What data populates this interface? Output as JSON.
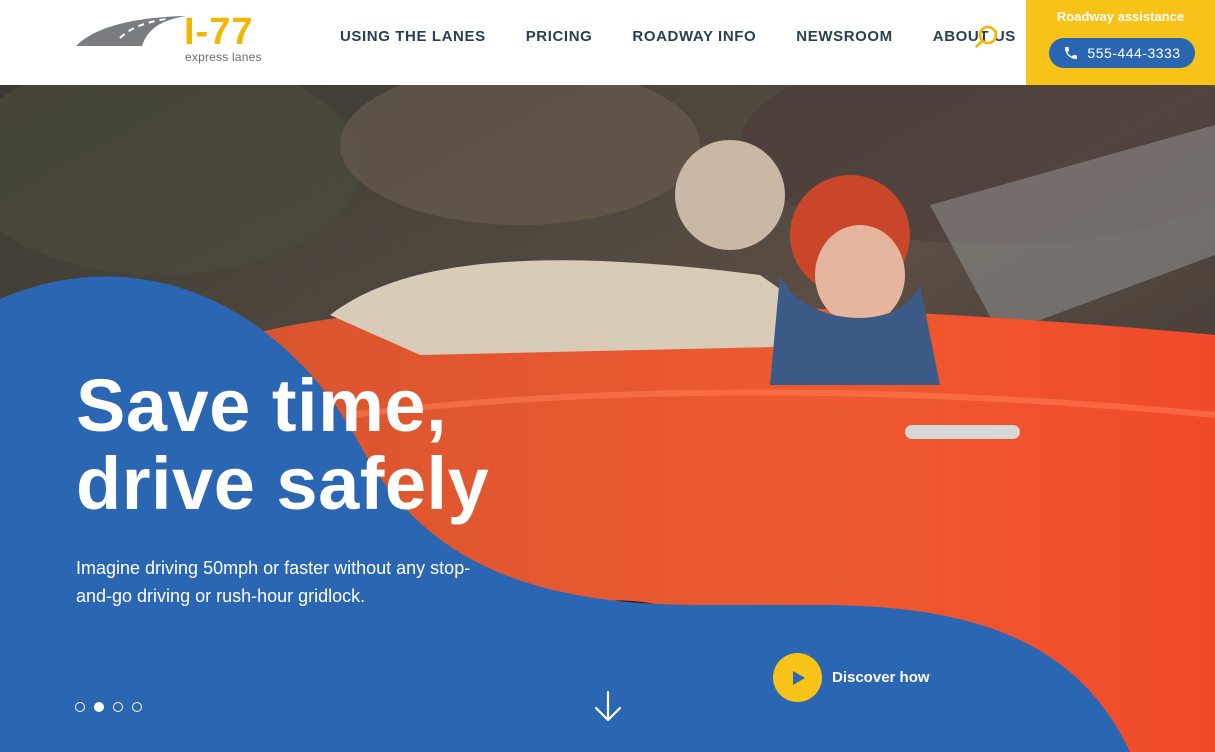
{
  "header": {
    "logo": {
      "main": "I-77",
      "sub": "express lanes"
    },
    "nav": [
      {
        "label": "USING THE LANES"
      },
      {
        "label": "PRICING"
      },
      {
        "label": "ROADWAY INFO"
      },
      {
        "label": "NEWSROOM"
      },
      {
        "label": "ABOUT US"
      }
    ],
    "search_icon": "search-icon",
    "assistance": {
      "label": "Roadway assistance",
      "phone": "555-444-3333",
      "phone_icon": "phone-icon"
    }
  },
  "hero": {
    "title_line1": "Save time,",
    "title_line2": "drive safely",
    "subtitle": "Imagine driving 50mph or faster without any stop-and-go driving or rush-hour gridlock.",
    "cta_label": "Discover how",
    "cta_icon": "play-icon",
    "scroll_icon": "arrow-down-icon",
    "carousel": {
      "slides": 4,
      "active_index": 1
    }
  },
  "colors": {
    "brand_yellow": "#f7c318",
    "brand_blue": "#2b66b3",
    "nav_text": "#2a3e55",
    "car_red": "#e8502e"
  }
}
